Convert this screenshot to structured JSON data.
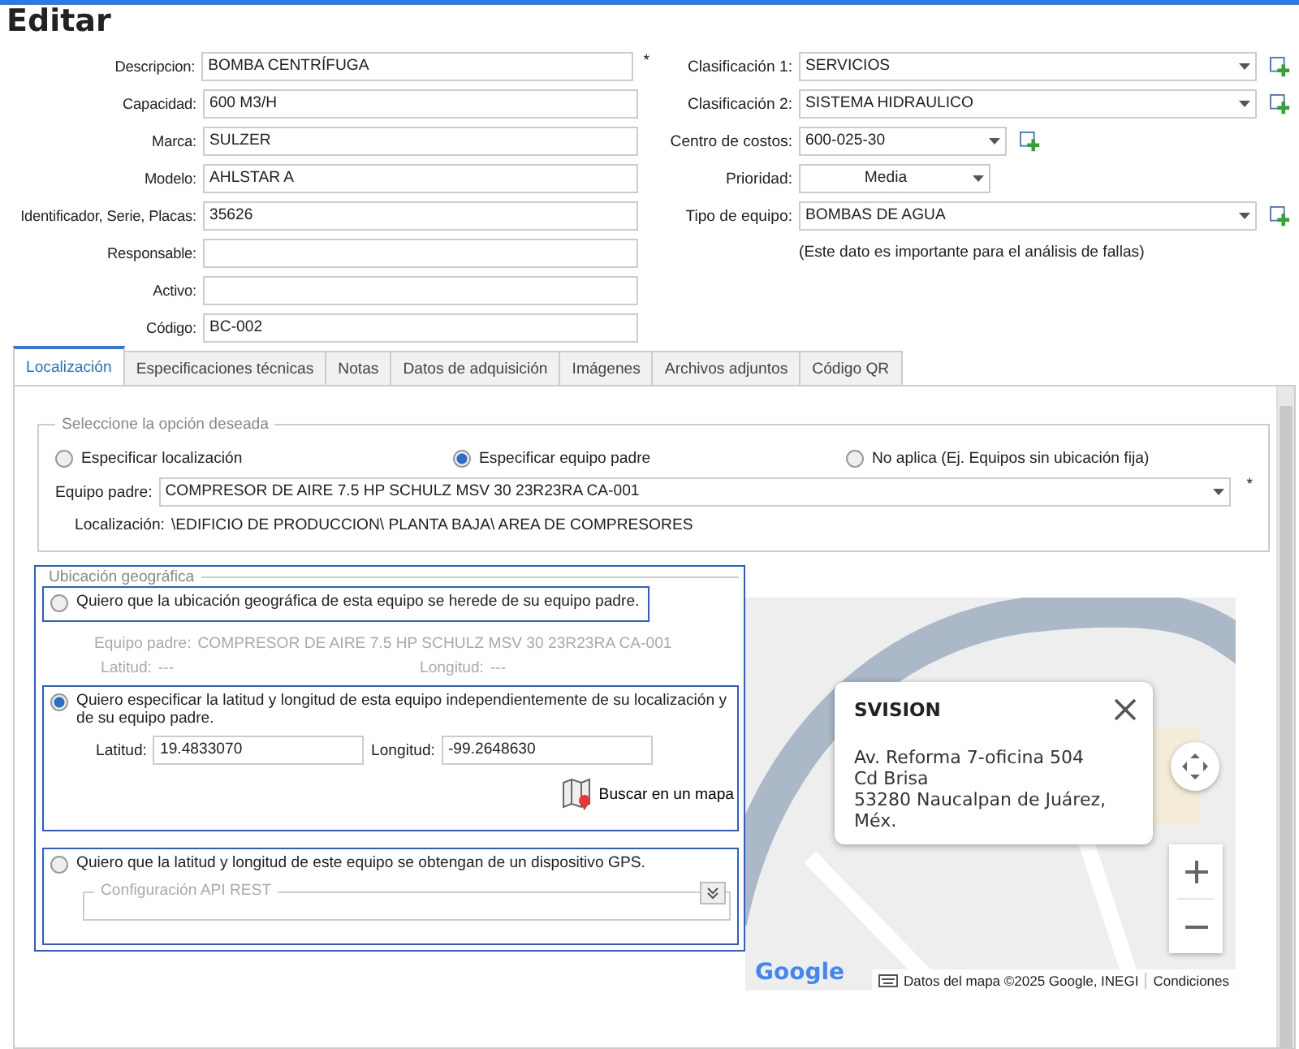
{
  "title": "Editar",
  "left_fields": [
    {
      "label": "Descripcion:",
      "value": "BOMBA CENTRÍFUGA",
      "required_mark": "*"
    },
    {
      "label": "Capacidad:",
      "value": "600 M3/H"
    },
    {
      "label": "Marca:",
      "value": "SULZER"
    },
    {
      "label": "Modelo:",
      "value": "AHLSTAR A"
    },
    {
      "label": "Identificador, Serie, Placas:",
      "value": "35626"
    },
    {
      "label": "Responsable:"
    },
    {
      "label": "Activo:"
    },
    {
      "label": "Código:",
      "value": "BC-002"
    }
  ],
  "right_fields": [
    {
      "label": "Clasificación 1:",
      "value": "SERVICIOS",
      "kind": "wide",
      "add": true
    },
    {
      "label": "Clasificación 2:",
      "value": "SISTEMA HIDRAULICO",
      "kind": "wide",
      "add": true
    },
    {
      "label": "Centro de costos:",
      "value": "600-025-30",
      "kind": "medium",
      "add": true
    },
    {
      "label": "Prioridad:",
      "value": "Media",
      "kind": "short",
      "add": false
    },
    {
      "label": "Tipo de equipo:",
      "value": "BOMBAS DE AGUA",
      "kind": "wide",
      "add": true
    }
  ],
  "note": "(Este dato es importante para el análisis de fallas)",
  "tabs": [
    {
      "label": "Localización",
      "selected": true
    },
    {
      "label": "Especificaciones técnicas",
      "selected": false
    },
    {
      "label": "Notas",
      "selected": false
    },
    {
      "label": "Datos de adquisición",
      "selected": false
    },
    {
      "label": "Imágenes",
      "selected": false
    },
    {
      "label": "Archivos adjuntos",
      "selected": false
    },
    {
      "label": "Código QR",
      "selected": false
    }
  ],
  "location_group": {
    "legend": "Seleccione la opción deseada",
    "options": [
      {
        "label": "Especificar localización",
        "selected": false
      },
      {
        "label": "Especificar equipo padre",
        "selected": true
      },
      {
        "label": "No aplica (Ej. Equipos sin ubicación fija)",
        "selected": false
      }
    ],
    "parent_label": "Equipo padre:",
    "parent_value": "COMPRESOR DE AIRE 7.5 HP SCHULZ MSV 30 23R23RA CA-001",
    "required_mark": "*",
    "location_label": "Localización:",
    "location_value": "\\EDIFICIO DE PRODUCCION\\ PLANTA BAJA\\ AREA DE COMPRESORES"
  },
  "geo_group": {
    "legend": "Ubicación geográfica",
    "options": [
      {
        "kind": "inherit",
        "label": "Quiero que la ubicación geográfica de esta equipo se herede de su equipo padre.",
        "selected": false,
        "parent_label": "Equipo padre:",
        "parent_value": "COMPRESOR DE AIRE 7.5 HP SCHULZ MSV 30 23R23RA CA-001",
        "lat_label": "Latitud:",
        "lat_value": "---",
        "lng_label": "Longitud:",
        "lng_value": "---"
      },
      {
        "kind": "manual",
        "label": "Quiero especificar la latitud y longitud de esta equipo independientemente de su localización y de su equipo padre.",
        "selected": true,
        "lat_label": "Latitud:",
        "lat_value": "19.4833070",
        "lng_label": "Longitud:",
        "lng_value": "-99.2648630",
        "map_button": "Buscar en un mapa"
      },
      {
        "kind": "gps",
        "label": "Quiero que la latitud y longitud de este equipo se obtengan de un dispositivo GPS.",
        "selected": false,
        "config_legend": "Configuración API REST",
        "config_expanded": false
      }
    ]
  },
  "map": {
    "popup": {
      "title": "SVISION",
      "lines": [
        "Av. Reforma 7-oficina 504",
        "Cd Brisa",
        "53280 Naucalpan de Juárez,",
        "Méx."
      ]
    },
    "logo": "Google",
    "attribution": "Datos del mapa ©2025 Google, INEGI",
    "terms": "Condiciones"
  }
}
